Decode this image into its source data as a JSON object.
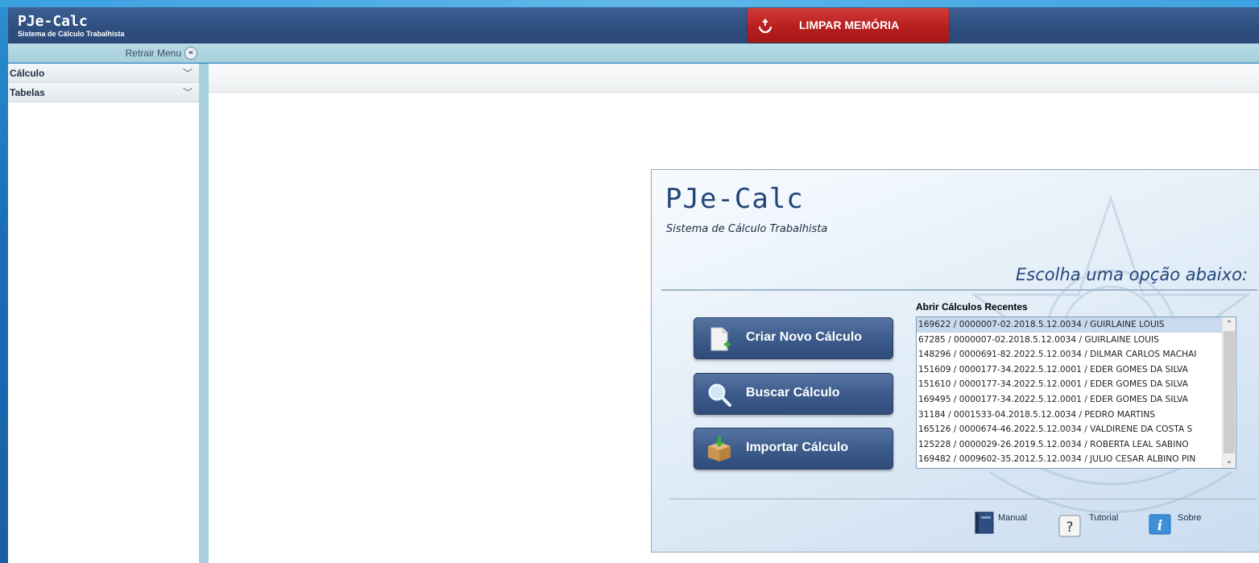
{
  "header": {
    "app_title": "PJe-Calc",
    "app_subtitle": "Sistema de Cálculo Trabalhista",
    "clear_memory_label": "LIMPAR MEMÓRIA"
  },
  "subbar": {
    "retract_menu_label": "Retrair Menu"
  },
  "sidebar": {
    "items": [
      {
        "label": "Cálculo"
      },
      {
        "label": "Tabelas"
      }
    ]
  },
  "panel": {
    "title": "PJe-Calc",
    "subtitle": "Sistema de Cálculo Trabalhista",
    "choose_label": "Escolha uma opção abaixo:",
    "actions": [
      {
        "label": "Criar Novo Cálculo",
        "icon": "new-document-icon"
      },
      {
        "label": "Buscar Cálculo",
        "icon": "magnifier-icon"
      },
      {
        "label": "Importar Cálculo",
        "icon": "import-box-icon"
      }
    ],
    "recent_heading": "Abrir Cálculos Recentes",
    "recent": [
      "169622 / 0000007-02.2018.5.12.0034 / GUIRLAINE LOUIS",
      "67285 / 0000007-02.2018.5.12.0034 / GUIRLAINE LOUIS",
      "148296 / 0000691-82.2022.5.12.0034 / DILMAR CARLOS MACHAI",
      "151609 / 0000177-34.2022.5.12.0001 / EDER GOMES DA SILVA",
      "151610 / 0000177-34.2022.5.12.0001 / EDER GOMES DA SILVA",
      "169495 / 0000177-34.2022.5.12.0001 / EDER GOMES DA SILVA",
      "31184 / 0001533-04.2018.5.12.0034 / PEDRO MARTINS",
      "165126 / 0000674-46.2022.5.12.0034 / VALDIRENE DA COSTA S",
      "125228 / 0000029-26.2019.5.12.0034 / ROBERTA LEAL SABINO",
      "169482 / 0009602-35.2012.5.12.0034 / JULIO CESAR ALBINO PIN"
    ],
    "footer": {
      "manual_label": "Manual",
      "tutorial_label": "Tutorial",
      "about_label": "Sobre"
    }
  },
  "colors": {
    "header_bg": "#2f4f80",
    "clear_button": "#b81e1e",
    "action_button": "#3d5c8c",
    "accent_title": "#24457a",
    "selected_row": "#c9d9ee"
  }
}
